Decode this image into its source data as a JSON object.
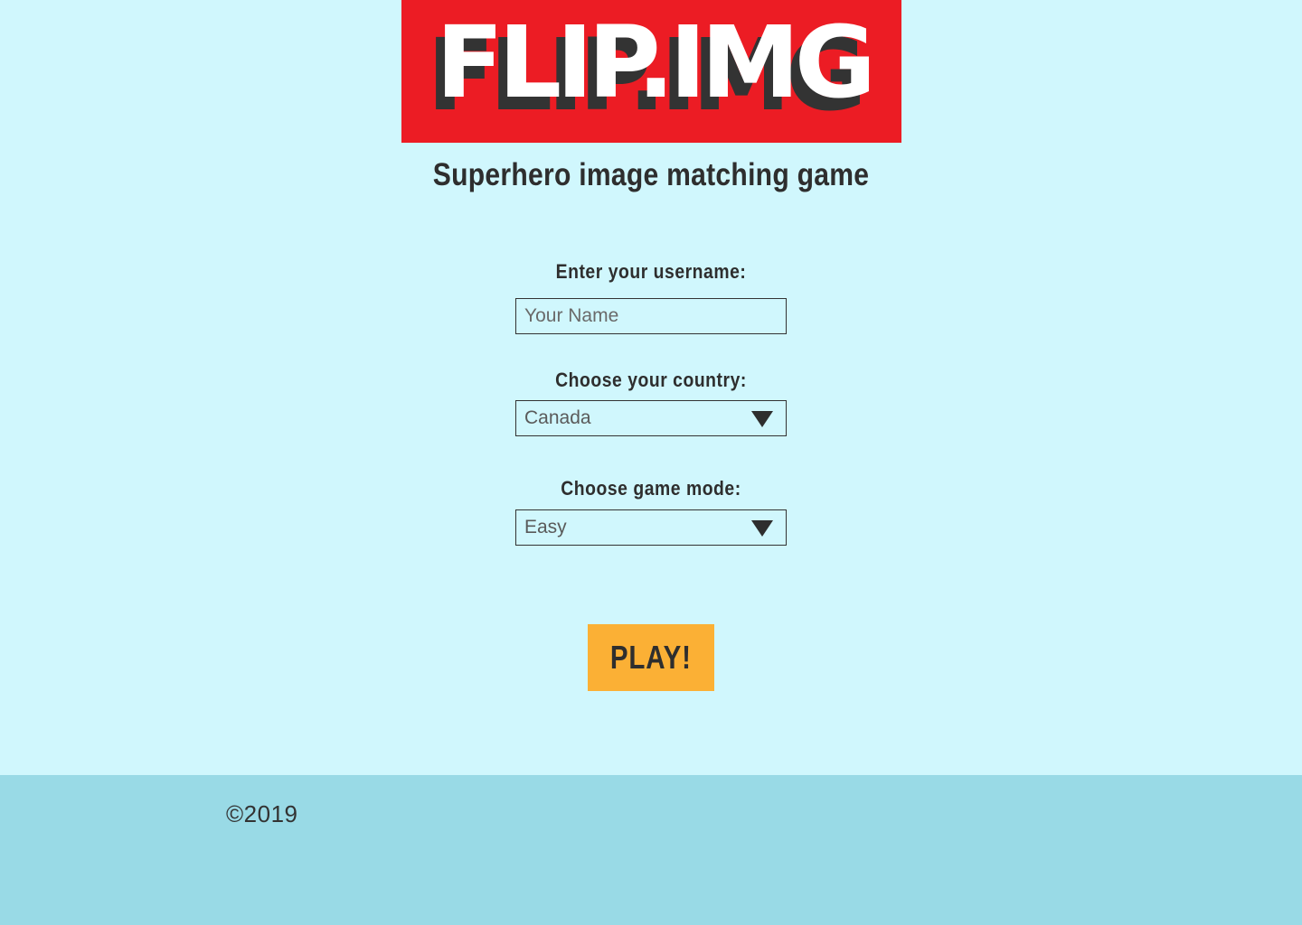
{
  "header": {
    "logo_text": "FLIP.IMG",
    "tagline": "Superhero image matching game"
  },
  "form": {
    "username": {
      "label": "Enter your username:",
      "value": "",
      "placeholder": "Your Name"
    },
    "country": {
      "label": "Choose your country:",
      "selected": "Canada"
    },
    "mode": {
      "label": "Choose game mode:",
      "selected": "Easy"
    },
    "play_label": "PLAY!"
  },
  "footer": {
    "copyright": "©2019"
  },
  "colors": {
    "background": "#d0f7fd",
    "logo_red": "#ec1c24",
    "play_orange": "#fbb035",
    "footer": "#99dae6",
    "text": "#2e2e2e"
  },
  "icons": {
    "select_caret": "caret-down-icon"
  }
}
